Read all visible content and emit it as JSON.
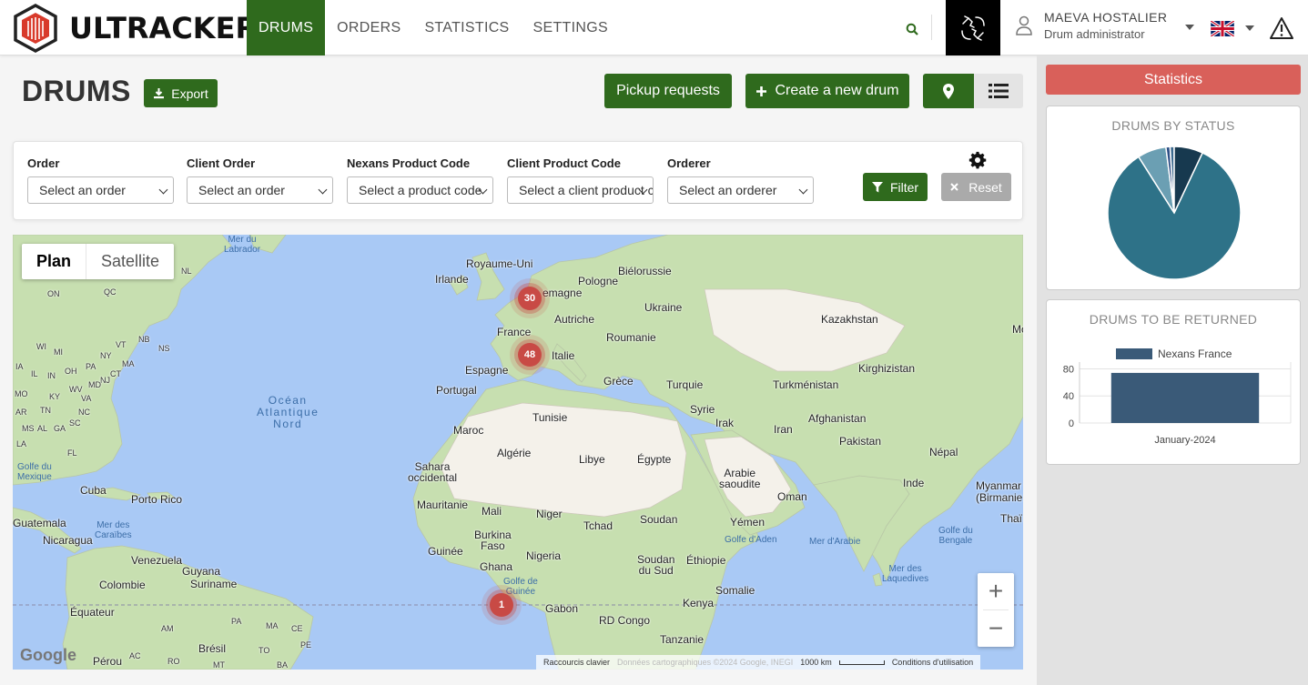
{
  "app": {
    "name": "ULTRACKER"
  },
  "nav": {
    "items": [
      {
        "label": "DRUMS",
        "active": true
      },
      {
        "label": "ORDERS",
        "active": false
      },
      {
        "label": "STATISTICS",
        "active": false
      },
      {
        "label": "SETTINGS",
        "active": false
      }
    ]
  },
  "user": {
    "name": "MAEVA HOSTALIER",
    "role": "Drum administrator"
  },
  "page": {
    "title": "DRUMS"
  },
  "actions": {
    "export": "Export",
    "pickup": "Pickup requests",
    "create": "Create a new drum"
  },
  "filters": {
    "fields": [
      {
        "label": "Order",
        "placeholder": "Select an order"
      },
      {
        "label": "Client Order",
        "placeholder": "Select an order"
      },
      {
        "label": "Nexans Product Code",
        "placeholder": "Select a product code"
      },
      {
        "label": "Client Product Code",
        "placeholder": "Select a client product code"
      },
      {
        "label": "Orderer",
        "placeholder": "Select an orderer"
      }
    ],
    "filter_label": "Filter",
    "reset_label": "Reset"
  },
  "map": {
    "type_plan": "Plan",
    "type_satellite": "Satellite",
    "clusters": [
      "30",
      "48",
      "1"
    ],
    "labels": {
      "labrador": "Mer du\nLabrador",
      "on": "ON",
      "qc": "QC",
      "nb": "NB",
      "ns": "NS",
      "nl": "NL",
      "wi": "WI",
      "mi": "MI",
      "ia": "IA",
      "il": "IL",
      "in": "IN",
      "oh": "OH",
      "pa": "PA",
      "ny": "NY",
      "vt": "VT",
      "ma": "MA",
      "ct": "CT",
      "nj": "NJ",
      "md": "MD",
      "wv": "WV",
      "va": "VA",
      "ky": "KY",
      "tn": "TN",
      "nc": "NC",
      "sc": "SC",
      "ms": "MS",
      "al": "AL",
      "ga": "GA",
      "ar": "AR",
      "la": "LA",
      "mo": "MO",
      "fl": "FL",
      "golfe_mexique": "Golfe du\nMexique",
      "cuba": "Cuba",
      "porto_rico": "Porto Rico",
      "guatemala": "Guatemala",
      "caraibes": "Mer des\nCaraïbes",
      "nicaragua": "Nicaragua",
      "venezuela": "Venezuela",
      "guyana": "Guyana",
      "suriname": "Suriname",
      "colombie": "Colombie",
      "equateur": "Équateur",
      "perou": "Pérou",
      "bresil": "Brésil",
      "am": "AM",
      "pa_br": "PA",
      "ma_br": "MA",
      "ce": "CE",
      "pe": "PE",
      "to": "TO",
      "ba": "BA",
      "mt": "MT",
      "ro": "RO",
      "ac": "AC",
      "ocean": "Océan\nAtlantique\nNord",
      "royaume_uni": "Royaume-Uni",
      "irlande": "Irlande",
      "allemagne": "emagne",
      "bielorussie": "Biélorussie",
      "pologne": "Pologne",
      "ukraine": "Ukraine",
      "france": "France",
      "autriche": "Autriche",
      "roumanie": "Roumanie",
      "italie": "Italie",
      "espagne": "Espagne",
      "portugal": "Portugal",
      "grece": "Grèce",
      "turquie": "Turquie",
      "kazakhstan": "Kazakhstan",
      "kirghizistan": "Kirghizistan",
      "turkmenistan": "Turkménistan",
      "afghanistan": "Afghanistan",
      "syrie": "Syrie",
      "irak": "Irak",
      "iran": "Iran",
      "pakistan": "Pakistan",
      "nepal": "Népal",
      "inde": "Inde",
      "myanmar": "Myanmar\n(Birmanie",
      "thai": "Thaï",
      "mo_asia": "Mo",
      "arabie": "Arabie\nsaoudite",
      "oman": "Oman",
      "yemen": "Yémen",
      "golfe_aden": "Golfe d'Aden",
      "mer_arabie": "Mer d'Arabie",
      "golfe_bengale": "Golfe du\nBengale",
      "laquedives": "Mer des\nLaquedives",
      "maroc": "Maroc",
      "tunisie": "Tunisie",
      "algerie": "Algérie",
      "libye": "Libye",
      "egypte": "Égypte",
      "sahara": "Sahara\noccidental",
      "mauritanie": "Mauritanie",
      "mali": "Mali",
      "niger": "Niger",
      "tchad": "Tchad",
      "soudan": "Soudan",
      "burkina": "Burkina\nFaso",
      "guinee": "Guinée",
      "nigeria": "Nigeria",
      "ghana": "Ghana",
      "golfe_guinee": "Golfe de\nGuinée",
      "soudan_sud": "Soudan\ndu Sud",
      "ethiopie": "Éthiopie",
      "somalie": "Somalie",
      "kenya": "Kenya",
      "gabon": "Gabon",
      "rd_congo": "RD Congo",
      "tanzanie": "Tanzanie"
    },
    "google": "Google",
    "attribution": {
      "shortcuts": "Raccourcis clavier",
      "data": "Données cartographiques ©2024 Google, INEGI",
      "scale": "1000 km",
      "terms": "Conditions d'utilisation"
    }
  },
  "sidebar": {
    "stats_button": "Statistics",
    "status_card": {
      "title": "DRUMS BY STATUS",
      "chart_data": {
        "type": "pie",
        "values": [
          84,
          7,
          1,
          1,
          7
        ],
        "colors": [
          "#2e7288",
          "#6b9fb3",
          "#2e4f86",
          "#3c6a8f",
          "#17394f"
        ]
      }
    },
    "return_card": {
      "title": "DRUMS TO BE RETURNED",
      "chart_data": {
        "type": "bar",
        "categories": [
          "January-2024"
        ],
        "series": [
          {
            "name": "Nexans France",
            "values": [
              74
            ]
          }
        ],
        "yticks": [
          "0",
          "40",
          "80"
        ],
        "ylim": [
          0,
          90
        ]
      }
    }
  },
  "colors": {
    "primary": "#2f6a1d",
    "stats": "#d9605a",
    "cluster": "#c84a45",
    "bar": "#3a5a78"
  }
}
